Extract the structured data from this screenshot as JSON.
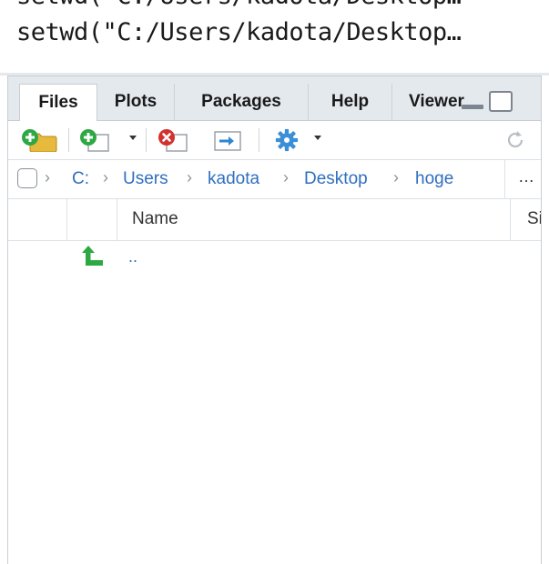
{
  "console": {
    "previous_line": "setwd(\"C:/Users/kadota/Desktop…",
    "current_line": "setwd(\"C:/Users/kadota/Desktop…"
  },
  "tabs": [
    {
      "label": "Files",
      "active": true
    },
    {
      "label": "Plots",
      "active": false
    },
    {
      "label": "Packages",
      "active": false
    },
    {
      "label": "Help",
      "active": false
    },
    {
      "label": "Viewer",
      "active": false
    }
  ],
  "toolbar": {
    "icons": [
      "new-folder-icon",
      "new-file-icon",
      "delete-icon",
      "rename-icon",
      "gear-icon",
      "refresh-icon"
    ]
  },
  "breadcrumb": {
    "items": [
      "C:",
      "Users",
      "kadota",
      "Desktop",
      "hoge"
    ],
    "more": "…"
  },
  "table": {
    "columns": [
      "Name",
      "Size"
    ],
    "rows": [
      {
        "name": ".."
      }
    ]
  },
  "colors": {
    "link": "#2f6fbf",
    "green": "#2ea843",
    "red": "#d1322f",
    "tabbar": "#e4e9ee"
  }
}
